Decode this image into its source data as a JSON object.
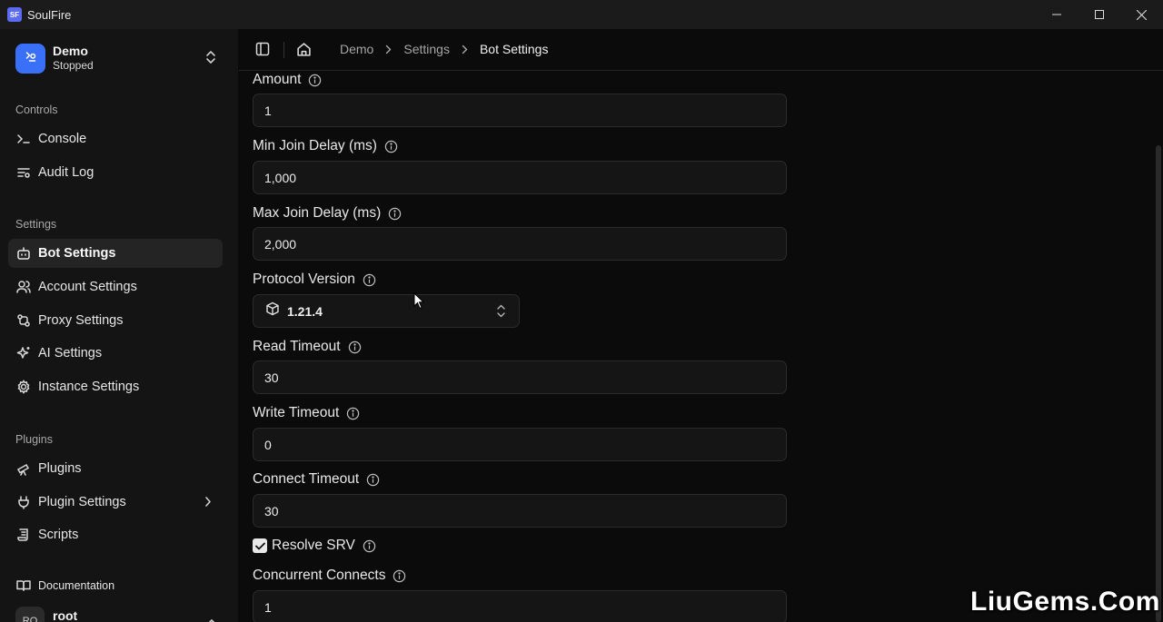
{
  "window": {
    "title": "SoulFire",
    "logo_text": "SF"
  },
  "sidebar": {
    "team": {
      "name": "Demo",
      "status": "Stopped"
    },
    "groups": {
      "controls": "Controls",
      "settings": "Settings",
      "plugins": "Plugins"
    },
    "items": [
      {
        "label": "Console",
        "icon": "terminal-icon"
      },
      {
        "label": "Audit Log",
        "icon": "log-list-icon"
      },
      {
        "label": "Bot Settings",
        "icon": "bot-icon",
        "active": true
      },
      {
        "label": "Account Settings",
        "icon": "users-icon"
      },
      {
        "label": "Proxy Settings",
        "icon": "proxy-icon"
      },
      {
        "label": "AI Settings",
        "icon": "sparkles-icon"
      },
      {
        "label": "Instance Settings",
        "icon": "gear-icon"
      },
      {
        "label": "Plugins",
        "icon": "telescope-icon"
      },
      {
        "label": "Plugin Settings",
        "icon": "plug-icon"
      },
      {
        "label": "Scripts",
        "icon": "scroll-icon"
      },
      {
        "label": "Documentation",
        "icon": "book-icon"
      }
    ],
    "user": {
      "initials": "RO",
      "name": "root"
    }
  },
  "breadcrumb": [
    "Demo",
    "Settings",
    "Bot Settings"
  ],
  "fields": {
    "amount": {
      "label": "Amount",
      "value": "1"
    },
    "min_join_delay": {
      "label": "Min Join Delay (ms)",
      "value": "1,000"
    },
    "max_join_delay": {
      "label": "Max Join Delay (ms)",
      "value": "2,000"
    },
    "protocol_version": {
      "label": "Protocol Version",
      "value": "1.21.4"
    },
    "read_timeout": {
      "label": "Read Timeout",
      "value": "30"
    },
    "write_timeout": {
      "label": "Write Timeout",
      "value": "0"
    },
    "connect_timeout": {
      "label": "Connect Timeout",
      "value": "30"
    },
    "resolve_srv": {
      "label": "Resolve SRV",
      "checked": true
    },
    "concurrent_connects": {
      "label": "Concurrent Connects",
      "value": "1"
    }
  },
  "watermark": "LiuGems.Com"
}
